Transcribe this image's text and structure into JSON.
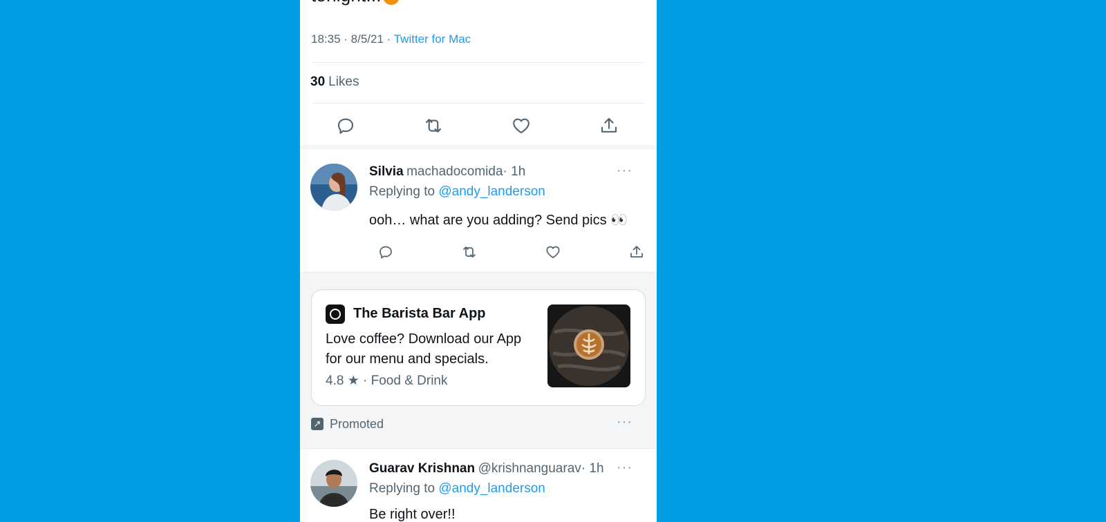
{
  "tweet": {
    "text_tail": "tonight...",
    "time": "18:35 · 8/5/21 · ",
    "source": "Twitter for Mac",
    "likes_count": "30",
    "likes_label": "Likes"
  },
  "reply1": {
    "name": "Silvia",
    "handle": "machadocomida",
    "time": "· 1h",
    "replying_prefix": "Replying to",
    "replying_to": "@andy_landerson",
    "text": "ooh… what are you adding? Send pics 👀"
  },
  "promo": {
    "app_name": "The Barista Bar App",
    "description_line1": "Love coffee? Download our App",
    "description_line2": "for our menu and specials.",
    "rating": "4.8 ★",
    "category": "· Food & Drink",
    "promoted_label": "Promoted"
  },
  "reply2": {
    "name": "Guarav Krishnan",
    "handle": "@krishnanguarav",
    "time": "· 1h",
    "replying_prefix": "Replying to",
    "replying_to": "@andy_landerson",
    "text": "Be right over!!"
  },
  "more_glyph": "···",
  "colors": {
    "background": "#009fe3",
    "link": "#1d9bf0",
    "muted": "#536471"
  }
}
